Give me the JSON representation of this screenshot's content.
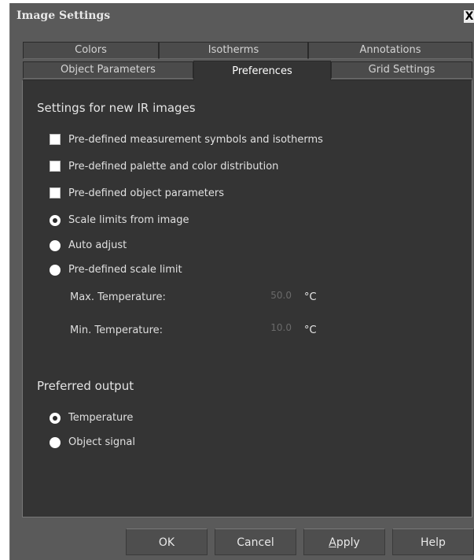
{
  "window": {
    "title": "Image Settings",
    "close_glyph": "X"
  },
  "tabs": {
    "row1": [
      {
        "label": "Colors"
      },
      {
        "label": "Isotherms"
      },
      {
        "label": "Annotations"
      }
    ],
    "row2": [
      {
        "label": "Object Parameters"
      },
      {
        "label": "Preferences",
        "active": true
      },
      {
        "label": "Grid Settings"
      }
    ]
  },
  "settings": {
    "section_title": "Settings for new IR images",
    "checkboxes": [
      {
        "label": "Pre-defined measurement symbols and isotherms",
        "checked": false
      },
      {
        "label": "Pre-defined palette and color distribution",
        "checked": false
      },
      {
        "label": "Pre-defined object parameters",
        "checked": false
      }
    ],
    "scale_options": [
      {
        "label": "Scale limits from image",
        "selected": true
      },
      {
        "label": "Auto adjust",
        "selected": false
      },
      {
        "label": "Pre-defined scale limit",
        "selected": false
      }
    ],
    "max_temp": {
      "label": "Max. Temperature:",
      "value": "50.0",
      "unit": "°C"
    },
    "min_temp": {
      "label": "Min. Temperature:",
      "value": "10.0",
      "unit": "°C"
    }
  },
  "output": {
    "section_title": "Preferred output",
    "options": [
      {
        "label": "Temperature",
        "selected": true
      },
      {
        "label": "Object signal",
        "selected": false
      }
    ]
  },
  "buttons": {
    "ok": "OK",
    "cancel": "Cancel",
    "apply_mnemonic": "A",
    "apply_rest": "pply",
    "help": "Help"
  }
}
